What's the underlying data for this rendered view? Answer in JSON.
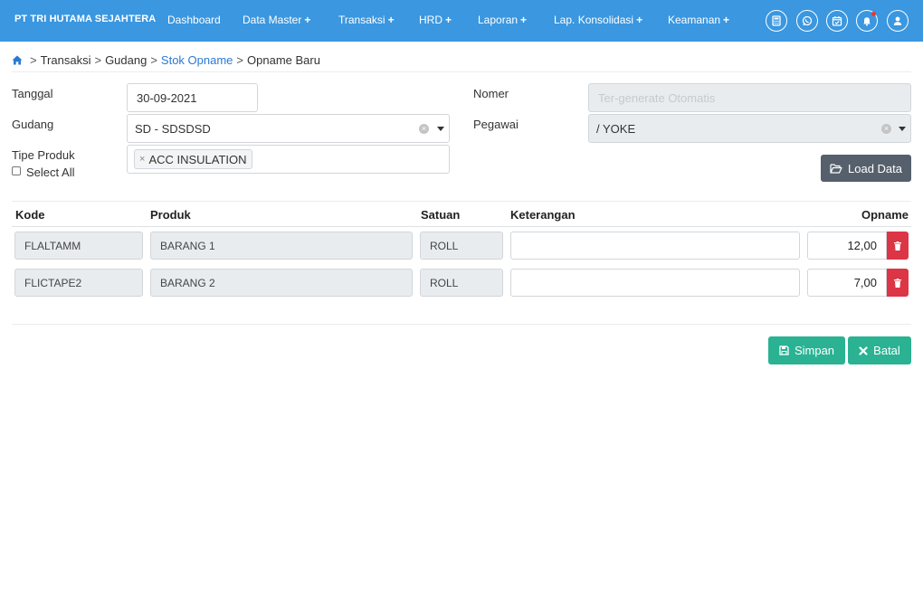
{
  "header": {
    "brand": "PT TRI HUTAMA SEJAHTERA",
    "nav": [
      {
        "label": "Dashboard",
        "plus": ""
      },
      {
        "label": "Data Master",
        "plus": "+"
      },
      {
        "label": "Transaksi",
        "plus": "+"
      },
      {
        "label": "HRD",
        "plus": "+"
      },
      {
        "label": "Laporan",
        "plus": "+"
      },
      {
        "label": "Lap. Konsolidasi",
        "plus": "+"
      },
      {
        "label": "Keamanan",
        "plus": "+"
      }
    ],
    "icons": [
      "calculator-icon",
      "whatsapp-icon",
      "calendar-check-icon",
      "bell-icon",
      "user-icon"
    ]
  },
  "breadcrumb": {
    "items": [
      "Transaksi",
      "Gudang",
      "Stok Opname",
      "Opname Baru"
    ],
    "separator": ">"
  },
  "form": {
    "tanggal_label": "Tanggal",
    "tanggal_value": "30-09-2021",
    "gudang_label": "Gudang",
    "gudang_value": "SD - SDSDSD",
    "tipe_label": "Tipe Produk",
    "tipe_tag": "ACC INSULATION",
    "select_all_label": "Select All",
    "nomer_label": "Nomer",
    "nomer_placeholder": "Ter-generate Otomatis",
    "pegawai_label": "Pegawai",
    "pegawai_value": "/ YOKE",
    "load_button": "Load Data"
  },
  "table": {
    "headers": {
      "kode": "Kode",
      "produk": "Produk",
      "satuan": "Satuan",
      "keterangan": "Keterangan",
      "opname": "Opname"
    },
    "rows": [
      {
        "kode": "FLALTAMM",
        "produk": "BARANG 1",
        "satuan": "ROLL",
        "keterangan": "",
        "opname": "12,00"
      },
      {
        "kode": "FLICTAPE2",
        "produk": "BARANG 2",
        "satuan": "ROLL",
        "keterangan": "",
        "opname": "7,00"
      }
    ]
  },
  "actions": {
    "save": "Simpan",
    "cancel": "Batal"
  },
  "colors": {
    "navbar": "#3a97e0",
    "link": "#2a7ad5",
    "success": "#2ab293",
    "danger": "#dc3545",
    "dark_button": "#56606c"
  }
}
